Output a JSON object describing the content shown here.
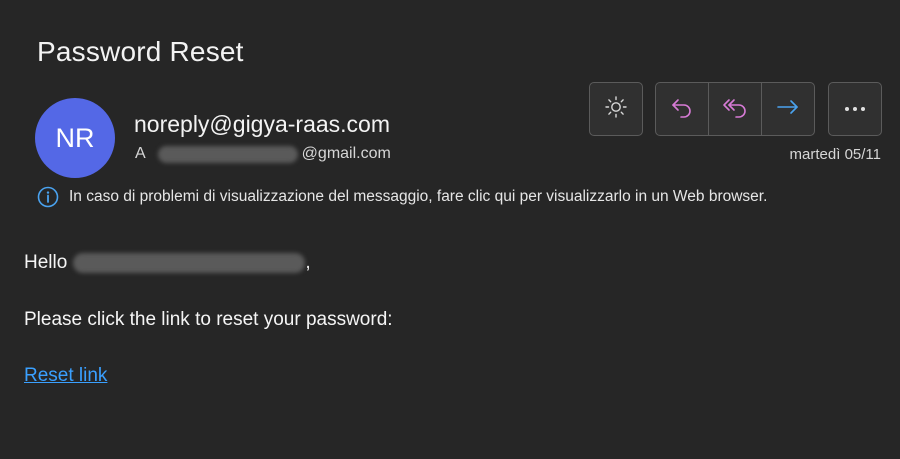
{
  "email": {
    "subject": "Password Reset",
    "sender_initials": "NR",
    "sender_address": "noreply@gigya-raas.com",
    "to_prefix": "A",
    "to_domain": "@gmail.com",
    "date": "martedì 05/11",
    "info_notice": "In caso di problemi di visualizzazione del messaggio, fare clic qui per visualizzarlo in un Web browser."
  },
  "toolbar": {
    "icons": [
      "sun-icon",
      "reply-icon",
      "reply-all-icon",
      "forward-icon",
      "more-icon"
    ]
  },
  "body": {
    "greeting": "Hello",
    "greeting_suffix": ",",
    "instruction": "Please click the link to reset your password:",
    "link_text": "Reset link"
  },
  "colors": {
    "background": "#262626",
    "avatar": "#5468e6",
    "link": "#3aa0ff",
    "reply_icon": "#d77bd6",
    "forward_icon": "#4aa3f0"
  }
}
